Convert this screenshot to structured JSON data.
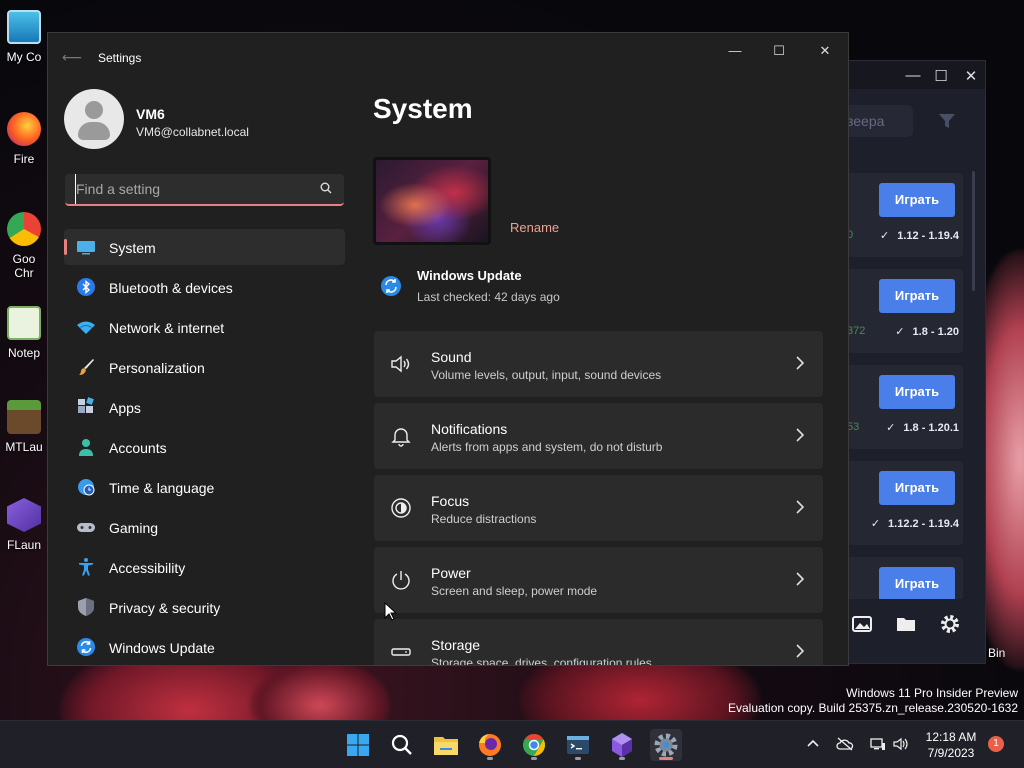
{
  "desktop": {
    "icons": [
      {
        "label": "My Co",
        "icon": "computer-icon"
      },
      {
        "label": "Fire",
        "icon": "firefox-icon"
      },
      {
        "label": "Goo Chr",
        "icon": "chrome-icon"
      },
      {
        "label": "Notep",
        "icon": "notepad-icon"
      },
      {
        "label": "MTLau",
        "icon": "minecraft-icon"
      },
      {
        "label": "FLaun",
        "icon": "flauncher-icon"
      }
    ],
    "recycle_label": "Bin",
    "watermark": {
      "line1": "Windows 11 Pro Insider Preview",
      "line2": "Evaluation copy. Build 25375.zn_release.230520-1632"
    }
  },
  "launcher": {
    "search_fragment": "зеера",
    "play_label": "Играть",
    "cards": [
      {
        "count": "0",
        "versions": "1.12 - 1.19.4"
      },
      {
        "count": "372",
        "versions": "1.8 - 1.20"
      },
      {
        "count": "53",
        "versions": "1.8 - 1.20.1"
      },
      {
        "count": "",
        "versions": "1.12.2 - 1.19.4"
      },
      {
        "count": "",
        "versions": ""
      }
    ]
  },
  "settings": {
    "window_title": "Settings",
    "user": {
      "name": "VM6",
      "email": "VM6@collabnet.local"
    },
    "search": {
      "placeholder": "Find a setting"
    },
    "nav": [
      {
        "label": "System",
        "icon": "monitor-icon",
        "active": true
      },
      {
        "label": "Bluetooth & devices",
        "icon": "bluetooth-icon"
      },
      {
        "label": "Network & internet",
        "icon": "wifi-icon"
      },
      {
        "label": "Personalization",
        "icon": "brush-icon"
      },
      {
        "label": "Apps",
        "icon": "apps-icon"
      },
      {
        "label": "Accounts",
        "icon": "person-icon"
      },
      {
        "label": "Time & language",
        "icon": "globe-clock-icon"
      },
      {
        "label": "Gaming",
        "icon": "gamepad-icon"
      },
      {
        "label": "Accessibility",
        "icon": "accessibility-icon"
      },
      {
        "label": "Privacy & security",
        "icon": "shield-icon"
      },
      {
        "label": "Windows Update",
        "icon": "update-icon"
      }
    ],
    "content": {
      "title": "System",
      "rename_label": "Rename",
      "windows_update": {
        "title": "Windows Update",
        "subtitle": "Last checked: 42 days ago"
      },
      "cards": [
        {
          "title": "Sound",
          "subtitle": "Volume levels, output, input, sound devices",
          "icon": "speaker-icon"
        },
        {
          "title": "Notifications",
          "subtitle": "Alerts from apps and system, do not disturb",
          "icon": "bell-icon"
        },
        {
          "title": "Focus",
          "subtitle": "Reduce distractions",
          "icon": "focus-icon"
        },
        {
          "title": "Power",
          "subtitle": "Screen and sleep, power mode",
          "icon": "power-icon"
        },
        {
          "title": "Storage",
          "subtitle": "Storage space, drives, configuration rules",
          "icon": "storage-icon"
        }
      ]
    }
  },
  "taskbar": {
    "apps": [
      {
        "name": "start-button",
        "icon": "windows-logo-icon"
      },
      {
        "name": "search-button",
        "icon": "search-icon"
      },
      {
        "name": "file-explorer",
        "icon": "folder-icon"
      },
      {
        "name": "firefox",
        "icon": "firefox-icon"
      },
      {
        "name": "chrome",
        "icon": "chrome-icon"
      },
      {
        "name": "terminal",
        "icon": "terminal-icon"
      },
      {
        "name": "flauncher",
        "icon": "flauncher-icon"
      },
      {
        "name": "settings",
        "icon": "gear-icon",
        "active": true
      }
    ],
    "clock": {
      "time": "12:18 AM",
      "date": "7/9/2023"
    },
    "notification_count": "1"
  },
  "colors": {
    "accent": "#e88080",
    "window_bg": "#202020",
    "card_bg": "#2b2b2b",
    "launcher_button": "#4a7ee8"
  }
}
